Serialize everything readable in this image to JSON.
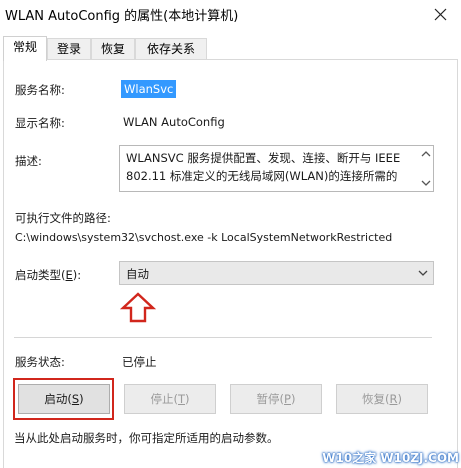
{
  "window": {
    "title": "WLAN AutoConfig 的属性(本地计算机)"
  },
  "tabs": [
    {
      "label": "常规",
      "active": true
    },
    {
      "label": "登录",
      "active": false
    },
    {
      "label": "恢复",
      "active": false
    },
    {
      "label": "依存关系",
      "active": false
    }
  ],
  "service": {
    "name_label": "服务名称:",
    "name_value": "WlanSvc",
    "display_label": "显示名称:",
    "display_value": "WLAN AutoConfig",
    "desc_label": "描述:",
    "desc_line1": "WLANSVC 服务提供配置、发现、连接、断开与 IEEE",
    "desc_line2": "802.11 标准定义的无线局域网(WLAN)的连接所需的",
    "path_label": "可执行文件的路径:",
    "path_value": "C:\\windows\\system32\\svchost.exe -k LocalSystemNetworkRestricted",
    "startup_label_pre": "启动类型(",
    "startup_label_key": "E",
    "startup_label_post": "):",
    "startup_value": "自动",
    "status_label": "服务状态:",
    "status_value": "已停止"
  },
  "buttons": {
    "start": {
      "pre": "启动(",
      "key": "S",
      "post": ")"
    },
    "stop": {
      "pre": "停止(",
      "key": "T",
      "post": ")"
    },
    "pause": {
      "pre": "暂停(",
      "key": "P",
      "post": ")"
    },
    "resume": {
      "pre": "恢复(",
      "key": "R",
      "post": ")"
    }
  },
  "hint": "当从此处启动服务时，你可指定所适用的启动参数。",
  "watermark": "W10之家 W10ZJ.COM",
  "colors": {
    "highlight_red": "#d1261c",
    "selection_blue": "#3399ff"
  }
}
